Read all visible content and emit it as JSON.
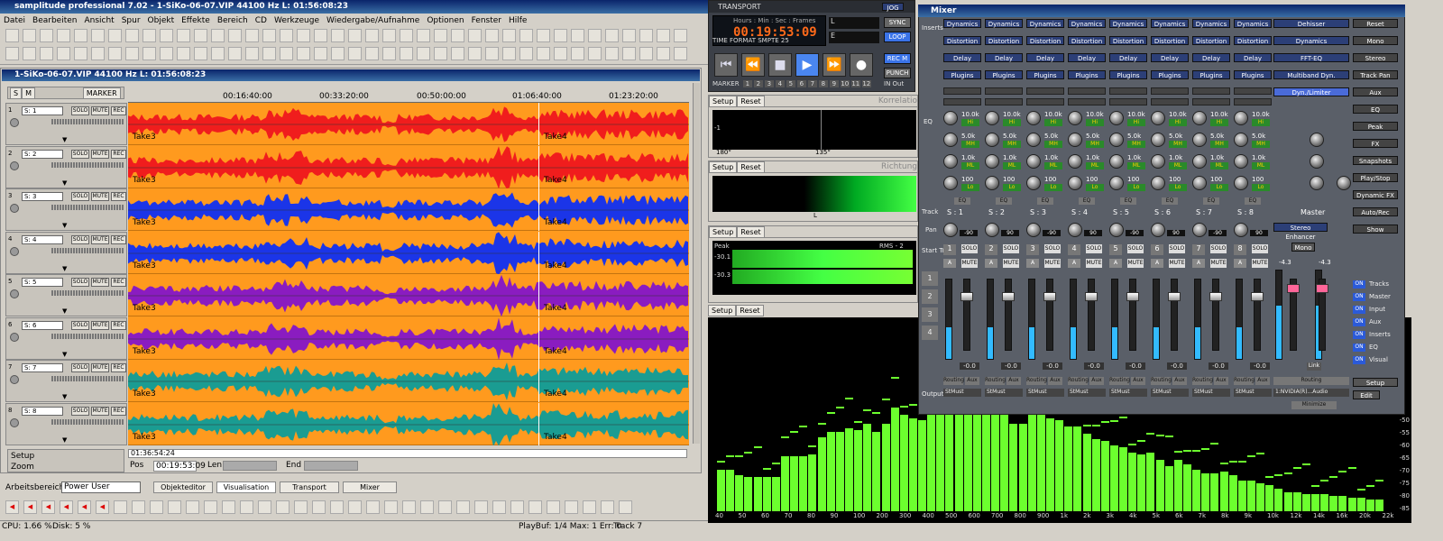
{
  "app": {
    "title": "samplitude professional 7.02 - 1-SiKo-06-07.VIP   44100 Hz L: 01:56:08:23"
  },
  "menu": [
    "Datei",
    "Bearbeiten",
    "Ansicht",
    "Spur",
    "Objekt",
    "Effekte",
    "Bereich",
    "CD",
    "Werkzeuge",
    "Wiedergabe/Aufnahme",
    "Optionen",
    "Fenster",
    "Hilfe"
  ],
  "toolbar": {
    "items": [
      "Auto",
      "Edit",
      "M",
      "M",
      "M",
      "M",
      "M",
      "M",
      "M",
      "M",
      "M",
      "M",
      "OPT",
      "REC"
    ]
  },
  "project": {
    "title": "1-SiKo-06-07.VIP   44100 Hz L: 01:56:08:23",
    "marker_label": "MARKER",
    "ticks": [
      "00:16:40:00",
      "00:33:20:00",
      "00:50:00:00",
      "01:06:40:00",
      "01:23:20:00"
    ],
    "tracks": [
      {
        "name": "S: 1",
        "color": "#f01d1d",
        "take_a": "Take3",
        "take_b": "Take4"
      },
      {
        "name": "S: 2",
        "color": "#f01d1d",
        "take_a": "Take3",
        "take_b": "Take4"
      },
      {
        "name": "S: 3",
        "color": "#1b35e8",
        "take_a": "Take3",
        "take_b": "Take4"
      },
      {
        "name": "S: 4",
        "color": "#1b35e8",
        "take_a": "Take3",
        "take_b": "Take4"
      },
      {
        "name": "S: 5",
        "color": "#8a1cc0",
        "take_a": "Take3",
        "take_b": "Take4"
      },
      {
        "name": "S: 6",
        "color": "#8a1cc0",
        "take_a": "Take3",
        "take_b": "Take4"
      },
      {
        "name": "S: 7",
        "color": "#1a9c92",
        "take_a": "Take3",
        "take_b": "Take4"
      },
      {
        "name": "S: 8",
        "color": "#1a9c92",
        "take_a": "Take3",
        "take_b": "Take4"
      }
    ],
    "track_buttons": [
      "SOLO",
      "MUTE",
      "REC"
    ],
    "setup_label": "Setup",
    "zoom_label": "Zoom",
    "bottom_time": "01:36:54:24",
    "pos_label": "Pos",
    "pos_value": "00:19:53:09",
    "len_label": "Len",
    "end_label": "End"
  },
  "workspace": {
    "label": "Arbeitsbereich:",
    "value": "Power User",
    "tabs": [
      "Objekteditor",
      "Visualisation",
      "Transport",
      "Mixer"
    ]
  },
  "status": {
    "cpu": "CPU: 1.66 %",
    "disk": "Disk: 5 %",
    "playbuf": "PlayBuf: 1/4 Max: 1 Err: 0",
    "track": "Track 7"
  },
  "transport": {
    "title": "TRANSPORT",
    "jog": "JOG",
    "time_header": "Hours : Min : Sec : Frames",
    "time": "00:19:53:09",
    "format_label": "TIME FORMAT",
    "smpte": "SMPTE 25",
    "l": "L",
    "e": "E",
    "sync": "SYNC",
    "loop": "LOOP",
    "rec_m": "REC M",
    "punch": "PUNCH",
    "in": "IN",
    "out": "Out",
    "marker": "MARKER",
    "markers": [
      "1",
      "2",
      "3",
      "4",
      "5",
      "6",
      "7",
      "8",
      "9",
      "10",
      "11",
      "12"
    ]
  },
  "vis": {
    "setup": "Setup",
    "reset": "Reset",
    "korr_label": "Korrelatio",
    "richt_label": "Richtung",
    "peak_label": "Peak",
    "rms_label": "RMS - 2",
    "correlation_ticks": [
      "-1",
      "180°",
      "135°",
      "0"
    ],
    "direction_label": "L",
    "peak_values": [
      "-30 dB",
      "-56 dB",
      "-70 dB",
      "-60 dB",
      "-50 dB",
      "-30.1",
      "-30.3"
    ],
    "spectrum_ticks": [
      "40",
      "50",
      "60",
      "70",
      "80",
      "90",
      "100",
      "200",
      "300",
      "400",
      "500",
      "600",
      "700",
      "800",
      "900",
      "1k",
      "2k",
      "3k",
      "4k",
      "5k",
      "6k",
      "7k",
      "8k",
      "9k",
      "10k",
      "12k",
      "14k",
      "16k",
      "20k",
      "22k"
    ],
    "spectrum_db": [
      "-50",
      "-55",
      "-60",
      "-65",
      "-70",
      "-75",
      "-80",
      "-85"
    ],
    "spectrum_values": [
      0.22,
      0.22,
      0.19,
      0.18,
      0.18,
      0.18,
      0.18,
      0.29,
      0.29,
      0.29,
      0.3,
      0.39,
      0.42,
      0.42,
      0.44,
      0.43,
      0.46,
      0.42,
      0.46,
      0.55,
      0.51,
      0.49,
      0.48,
      0.52,
      0.55,
      0.53,
      0.56,
      0.53,
      0.57,
      0.57,
      0.52,
      0.52,
      0.46,
      0.46,
      0.58,
      0.52,
      0.49,
      0.48,
      0.45,
      0.45,
      0.41,
      0.38,
      0.37,
      0.35,
      0.34,
      0.31,
      0.3,
      0.31,
      0.27,
      0.24,
      0.27,
      0.25,
      0.22,
      0.2,
      0.2,
      0.21,
      0.19,
      0.16,
      0.16,
      0.15,
      0.14,
      0.12,
      0.1,
      0.1,
      0.09,
      0.09,
      0.09,
      0.08,
      0.08,
      0.07,
      0.07,
      0.06,
      0.06
    ]
  },
  "mixer": {
    "title": "Mixer",
    "inserts_label": "Inserts",
    "eq_label": "EQ",
    "track_label": "Track",
    "pan_label": "Pan",
    "start_track": "Start Track",
    "output_label": "Output",
    "insert_buttons": [
      "Dynamics",
      "Distortion",
      "Delay",
      "Plugins"
    ],
    "eq_values": [
      "10.0k",
      "5.0k",
      "1.0k",
      "100"
    ],
    "eq_bands": [
      "Hi",
      "MH",
      "ML",
      "Lo"
    ],
    "eq_button": "EQ",
    "channels": [
      "S : 1",
      "S : 2",
      "S : 3",
      "S : 4",
      "S : 5",
      "S : 6",
      "S : 7",
      "S : 8"
    ],
    "channel_pan": [
      "-90",
      "90",
      "-90",
      "90",
      "-90",
      "90",
      "-90",
      "90"
    ],
    "channel_volume": "-0.0",
    "solo": "SOLO",
    "mute": "MUTE",
    "a": "A",
    "routing": "Routing",
    "aux": "Aux",
    "output_value": "StMust",
    "master_label": "Master",
    "master_buttons": [
      "Dehisser",
      "Dynamics",
      "FFT-EQ",
      "Multiband Dyn.",
      "Dyn./Limiter"
    ],
    "master_stereo": "Stereo Enhancer",
    "master_mono": "Mono",
    "master_db": [
      "-4.3",
      "-4.3"
    ],
    "master_out": "1:NVIDIA(R)...Audio",
    "minmen": "Minimize",
    "link": "Link",
    "right_panel": [
      "Reset",
      "Mono",
      "Stereo",
      "Track Pan",
      "Aux",
      "EQ",
      "Peak",
      "FX",
      "Snapshots",
      "Play/Stop",
      "Dynamic FX",
      "Auto/Rec",
      "Show"
    ],
    "show_items": [
      "Tracks",
      "Master",
      "Input",
      "Aux",
      "Inserts",
      "EQ",
      "Visual"
    ],
    "setup": "Setup",
    "edit": "Edit",
    "start_nums": [
      "1",
      "2",
      "3",
      "4"
    ]
  }
}
